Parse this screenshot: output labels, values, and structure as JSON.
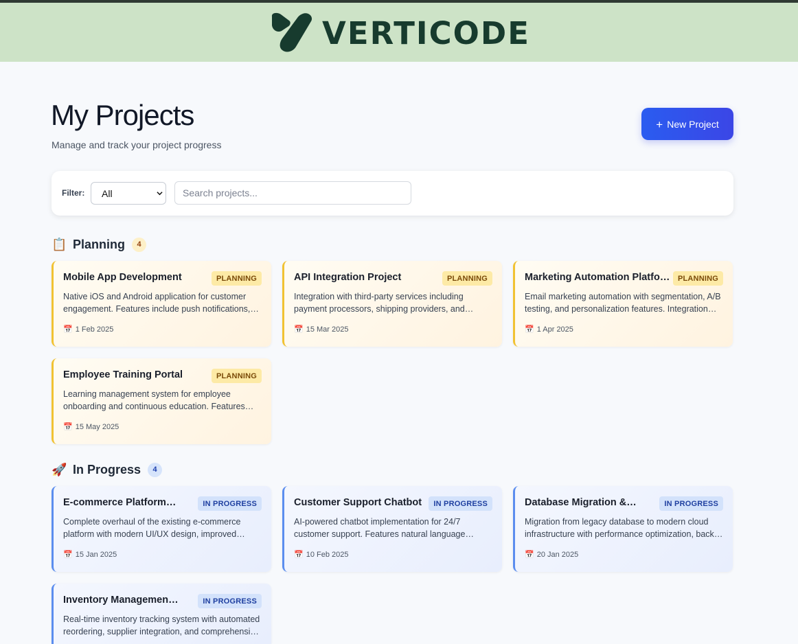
{
  "brand": {
    "name": "VERTICODE",
    "color": "#173b2e",
    "header_bg": "#cde3c7"
  },
  "page": {
    "title": "My Projects",
    "subtitle": "Manage and track your project progress",
    "new_project_label": "New Project",
    "new_project_icon": "plus-icon"
  },
  "filter": {
    "label": "Filter:",
    "selected": "All",
    "search_placeholder": "Search projects...",
    "search_value": ""
  },
  "sections": {
    "planning": {
      "icon": "📋",
      "title": "Planning",
      "count": "4",
      "accent": "#f1c232",
      "projects": [
        {
          "title": "Mobile App Development",
          "status": "PLANNING",
          "description": "Native iOS and Android application for customer engagement. Features include push notifications, offline mode and in-app purchases.",
          "date": "1 Feb 2025"
        },
        {
          "title": "API Integration Project",
          "status": "PLANNING",
          "description": "Integration with third-party services including payment processors, shipping providers, and analytics platforms.",
          "date": "15 Mar 2025"
        },
        {
          "title": "Marketing Automation Platform",
          "status": "PLANNING",
          "description": "Email marketing automation with segmentation, A/B testing, and personalization features. Integration with CRM systems.",
          "date": "1 Apr 2025"
        },
        {
          "title": "Employee Training Portal",
          "status": "PLANNING",
          "description": "Learning management system for employee onboarding and continuous education. Features course tracking and certificates.",
          "date": "15 May 2025"
        }
      ]
    },
    "in_progress": {
      "icon": "🚀",
      "title": "In Progress",
      "count": "4",
      "accent": "#5b8def",
      "projects": [
        {
          "title": "E-commerce Platform Redesign",
          "status": "IN PROGRESS",
          "description": "Complete overhaul of the existing e-commerce platform with modern UI/UX design, improved checkout flow and performance.",
          "date": "15 Jan 2025"
        },
        {
          "title": "Customer Support Chatbot",
          "status": "IN PROGRESS",
          "description": "AI-powered chatbot implementation for 24/7 customer support. Features natural language understanding and escalation.",
          "date": "10 Feb 2025"
        },
        {
          "title": "Database Migration & Optimization",
          "status": "IN PROGRESS",
          "description": "Migration from legacy database to modern cloud infrastructure with performance optimization, backup and recovery.",
          "date": "20 Jan 2025"
        },
        {
          "title": "Inventory Management System",
          "status": "IN PROGRESS",
          "description": "Real-time inventory tracking system with automated reordering, supplier integration, and comprehensive reporting.",
          "date": ""
        }
      ]
    }
  }
}
